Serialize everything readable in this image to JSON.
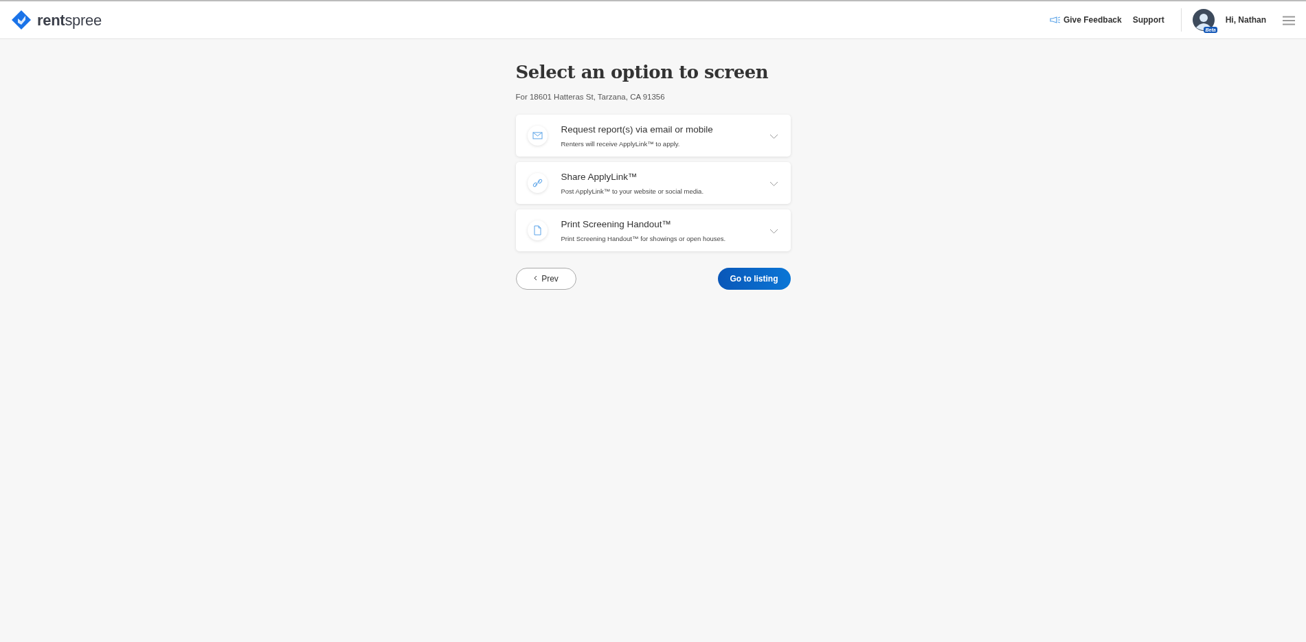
{
  "header": {
    "logo": "**rent**spree",
    "links": [
      "Give Feedback",
      "Support"
    ],
    "user": {
      "greeting": "Hi, Nathan",
      "badge": "Beta"
    }
  },
  "page": {
    "title": "Select an option to screen",
    "subtitle": "For 18601 Hatteras St, Tarzana, CA 91356"
  },
  "options": [
    {
      "kind": "email",
      "title": "Request report(s) via email or mobile",
      "description": "Renters will receive ApplyLink™ to apply.",
      "expanded": false
    },
    {
      "kind": "link",
      "title": "Share ApplyLink™",
      "description": "Post ApplyLink™ to your website or social media.",
      "expanded": false
    },
    {
      "kind": "handout",
      "title": "Print Screening Handout™",
      "description": "Print Screening Handout™ for showings or open houses.",
      "expanded": false
    }
  ],
  "buttons": {
    "prev": "Prev",
    "next": "Go to listing"
  }
}
